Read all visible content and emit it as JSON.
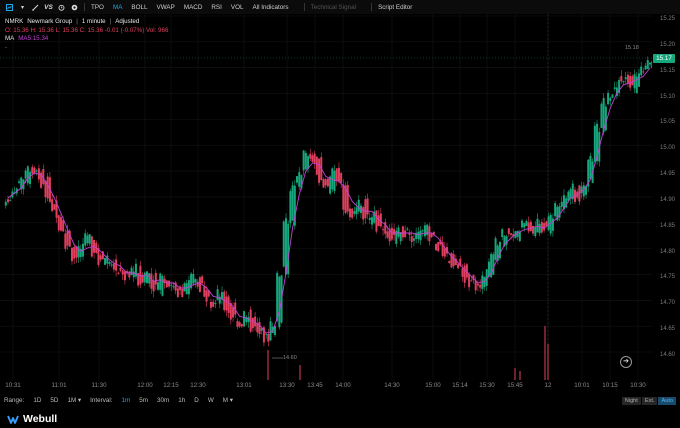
{
  "toolbar": {
    "icons": [
      "chart-type-icon",
      "indicator-icon",
      "drawing-icon",
      "compare-icon",
      "settings-icon"
    ],
    "items": [
      "TPO",
      "MA",
      "BOLL",
      "VWAP",
      "MACD",
      "RSI",
      "VOL",
      "All Indicators",
      "Technical Signal",
      "Script Editor"
    ],
    "active": "MA",
    "dim": "Technical Signal",
    "toggle_label": "▾"
  },
  "legend": {
    "symbol": "NMRK",
    "company": "Newmark Group",
    "interval": "1 minute",
    "adjusted": "Adjusted",
    "ohlc": "O: 15.36   H: 15.36   L: 15.36   C: 15.36   -0.01 (-0.07%)   Vol: 966",
    "ma_label": "MA",
    "ma5_label": "MA5:15.34",
    "extra": "-"
  },
  "price_axis": [
    "15.25",
    "15.20",
    "15.15",
    "15.10",
    "15.05",
    "15.00",
    "14.95",
    "14.90",
    "14.85",
    "14.80",
    "14.75",
    "14.70",
    "14.65",
    "14.60"
  ],
  "current_price": "15.17",
  "current_price_color": "#17a77d",
  "high_label": "15.18",
  "low_label": "14.60",
  "time_axis": [
    "10:31",
    "11:01",
    "11:30",
    "12:00",
    "12:15",
    "12:30",
    "13:01",
    "13:30",
    "13:45",
    "14:00",
    "14:30",
    "15:00",
    "15:14",
    "15:30",
    "15:45",
    "12",
    "10:01",
    "10:15",
    "10:30"
  ],
  "bottom_bar": {
    "range_label": "Range:",
    "ranges": [
      "1D",
      "5D",
      "1M ▾"
    ],
    "interval_label": "Interval:",
    "intervals": [
      "1m",
      "5m",
      "30m",
      "1h",
      "D",
      "W",
      "M ▾"
    ],
    "active_interval": "1m",
    "session": [
      "Night",
      "Ext.",
      "Auto"
    ],
    "active_session": "Auto"
  },
  "footer": {
    "brand": "Webull"
  },
  "colors": {
    "up": "#17a77d",
    "down": "#e0405e",
    "ma": "#c43fd6"
  },
  "chart_data": {
    "type": "candlestick",
    "symbol": "NMRK",
    "price_range": [
      14.58,
      15.26
    ],
    "ma_series": "MA5",
    "closes": [
      14.9,
      14.92,
      14.94,
      14.96,
      14.95,
      14.93,
      14.9,
      14.87,
      14.84,
      14.8,
      14.78,
      14.8,
      14.82,
      14.79,
      14.77,
      14.78,
      14.76,
      14.75,
      14.74,
      14.76,
      14.73,
      14.75,
      14.72,
      14.74,
      14.73,
      14.72,
      14.71,
      14.73,
      14.74,
      14.72,
      14.7,
      14.69,
      14.71,
      14.68,
      14.66,
      14.65,
      14.67,
      14.64,
      14.63,
      14.62,
      14.65,
      14.75,
      14.85,
      14.92,
      14.95,
      14.99,
      14.97,
      14.94,
      14.92,
      14.95,
      14.93,
      14.88,
      14.87,
      14.89,
      14.86,
      14.87,
      14.84,
      14.83,
      14.82,
      14.84,
      14.83,
      14.82,
      14.83,
      14.84,
      14.82,
      14.8,
      14.78,
      14.77,
      14.76,
      14.74,
      14.73,
      14.72,
      14.75,
      14.78,
      14.81,
      14.83,
      14.82,
      14.84,
      14.85,
      14.83,
      14.85,
      14.84,
      14.86,
      14.88,
      14.9,
      14.92,
      14.9,
      14.93,
      14.98,
      15.04,
      15.09,
      15.11,
      15.13,
      15.14,
      15.12,
      15.15,
      15.16,
      15.17
    ]
  }
}
